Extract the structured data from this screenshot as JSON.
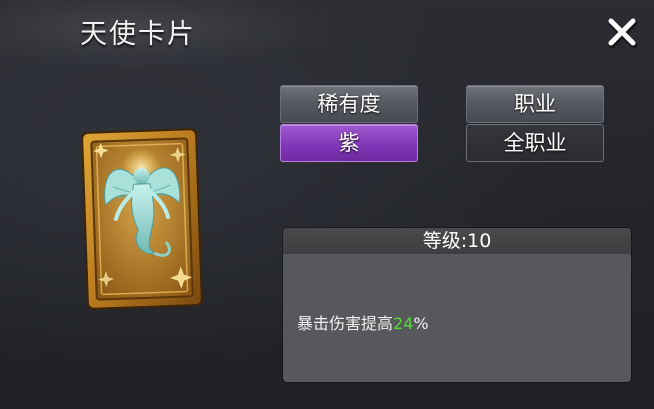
{
  "window": {
    "title": "天使卡片"
  },
  "rarity": {
    "label": "稀有度",
    "value": "紫"
  },
  "job": {
    "label": "职业",
    "value": "全职业"
  },
  "info": {
    "level_text": "等级:10",
    "effect_text": "暴击伤害提高",
    "effect_value": "24",
    "effect_unit": "%"
  },
  "icons": {
    "close": "close-icon",
    "card": "angel-card-image"
  },
  "colors": {
    "rarity_purple": "#8a3fc2",
    "effect_highlight": "#59d63a"
  }
}
